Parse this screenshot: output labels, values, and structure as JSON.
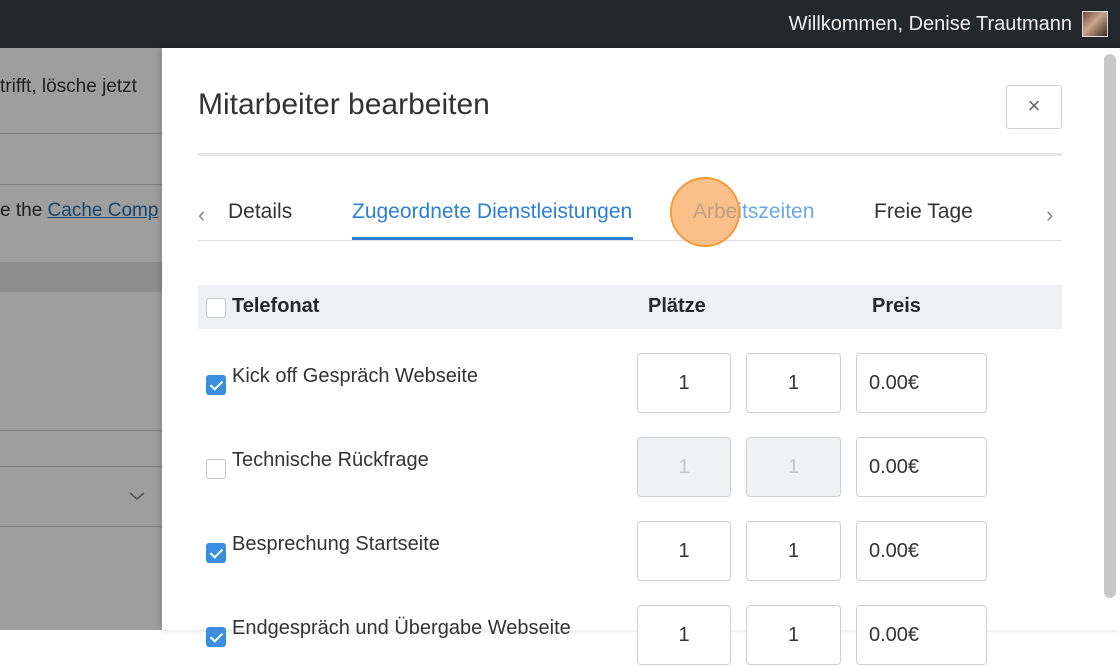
{
  "topbar": {
    "welcome": "Willkommen, Denise Trautmann"
  },
  "background": {
    "text1": "trifft, lösche jetzt",
    "text2_prefix": "e the ",
    "text2_link": "Cache Comp"
  },
  "modal": {
    "title": "Mitarbeiter bearbeiten",
    "close_label": "×",
    "tabs": [
      {
        "label": "Details"
      },
      {
        "label": "Zugeordnete Dienstleistungen"
      },
      {
        "label": "Arbeitszeiten"
      },
      {
        "label": "Freie Tage"
      }
    ],
    "active_tab": "Zugeordnete Dienstleistungen",
    "prev_arrow": "‹",
    "next_arrow": "›"
  },
  "table": {
    "group_header": "Telefonat",
    "col_places": "Plätze",
    "col_price": "Preis",
    "rows": [
      {
        "label": "Kick off Gespräch Webseite",
        "checked": true,
        "min": "1",
        "max": "1",
        "price": "0.00€"
      },
      {
        "label": "Technische Rückfrage",
        "checked": false,
        "min": "1",
        "max": "1",
        "price": "0.00€"
      },
      {
        "label": "Besprechung Startseite",
        "checked": true,
        "min": "1",
        "max": "1",
        "price": "0.00€"
      },
      {
        "label": "Endgespräch und Übergabe Webseite",
        "checked": true,
        "min": "1",
        "max": "1",
        "price": "0.00€"
      }
    ]
  },
  "colors": {
    "accent": "#2c7fd6",
    "checkbox": "#3b8de0",
    "topbar": "#23282d",
    "click_marker": "#f49a3c"
  }
}
